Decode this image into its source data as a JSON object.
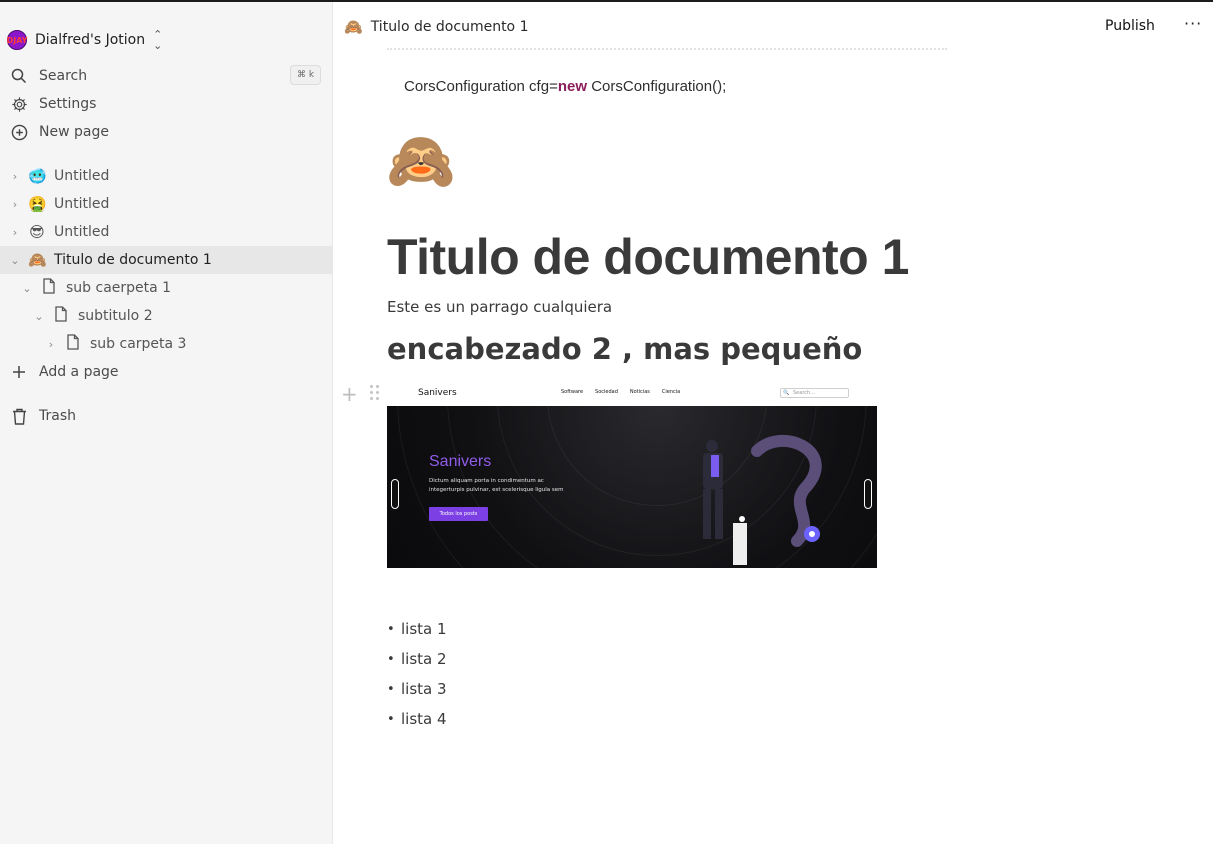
{
  "workspace": {
    "avatar_text": "DJAY",
    "name": "Dialfred's Jotion"
  },
  "sidebar": {
    "search_label": "Search",
    "search_shortcut": "⌘ k",
    "settings_label": "Settings",
    "new_page_label": "New page",
    "pages": [
      {
        "emoji": "🥶",
        "label": "Untitled"
      },
      {
        "emoji": "🤮",
        "label": "Untitled"
      },
      {
        "emoji": "😎",
        "label": "Untitled"
      },
      {
        "emoji": "🙈",
        "label": "Titulo de documento 1"
      }
    ],
    "subpages": [
      {
        "label": "sub caerpeta 1"
      },
      {
        "label": "subtitulo 2"
      },
      {
        "label": "sub carpeta 3"
      }
    ],
    "add_page_label": "Add a page",
    "trash_label": "Trash"
  },
  "header": {
    "emoji": "🙈",
    "title": "Titulo de documento 1",
    "publish_label": "Publish",
    "more_label": "···"
  },
  "document": {
    "code_before": "CorsConfiguration cfg=",
    "code_keyword": "new",
    "code_after": " CorsConfiguration();",
    "page_emoji": "🙈",
    "title": "Titulo de documento 1",
    "paragraph": "Este es un parrago cualquiera",
    "heading2": "encabezado 2 , mas pequeño",
    "image": {
      "brand": "Sanivers",
      "nav_links": [
        "Software",
        "Sociedad",
        "Noticias",
        "Ciencia"
      ],
      "search_placeholder": "Search...",
      "hero_title": "Sanivers",
      "hero_text": "Dictum aliquam porta in condimentum ac integerturpis pulvinar, est scelerisque ligula sem",
      "hero_button": "Todos los posts"
    },
    "list": [
      "lista 1",
      "lista 2",
      "lista 3",
      "lista 4"
    ]
  },
  "colors": {
    "accent": "#7b3fe4",
    "keyword": "#8b1e5b",
    "sidebar_bg": "#f5f5f5"
  }
}
